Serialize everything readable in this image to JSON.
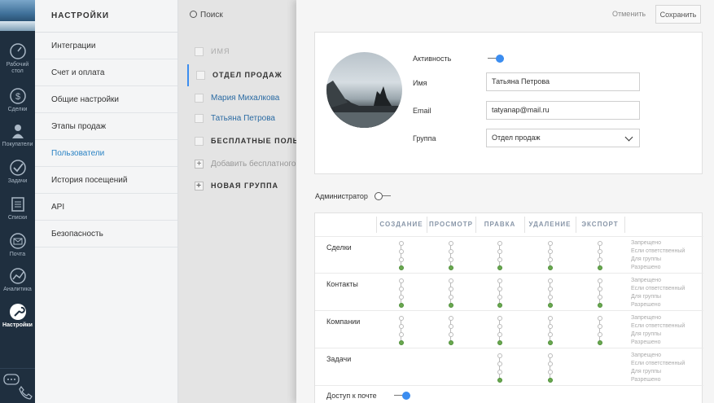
{
  "nav": {
    "items": [
      {
        "name": "desk",
        "label": "Рабочий стол",
        "icon": "speedometer-icon"
      },
      {
        "name": "deals",
        "label": "Сделки",
        "icon": "dollar-icon"
      },
      {
        "name": "customers",
        "label": "Покупатели",
        "icon": "customers-icon"
      },
      {
        "name": "tasks",
        "label": "Задачи",
        "icon": "checkmark-icon"
      },
      {
        "name": "lists",
        "label": "Списки",
        "icon": "list-icon"
      },
      {
        "name": "mail",
        "label": "Почта",
        "icon": "envelope-icon"
      },
      {
        "name": "analytics",
        "label": "Аналитика",
        "icon": "analytics-icon"
      },
      {
        "name": "settings",
        "label": "Настройки",
        "icon": "wrench-icon"
      }
    ]
  },
  "settings": {
    "title": "НАСТРОЙКИ",
    "items": [
      "Интеграции",
      "Счет и оплата",
      "Общие настройки",
      "Этапы продаж",
      "Пользователи",
      "История посещений",
      "API",
      "Безопасность"
    ],
    "active_index": 4
  },
  "list": {
    "search_placeholder": "Поиск",
    "header": "ИМЯ",
    "group_sales": "ОТДЕЛ ПРОДАЖ",
    "users": [
      "Мария Михалкова",
      "Татьяна Петрова"
    ],
    "group_free": "БЕСПЛАТНЫЕ ПОЛЬЗ",
    "add_free": "Добавить бесплатного п",
    "new_group": "НОВАЯ ГРУППА"
  },
  "panel": {
    "cancel_label": "Отменить",
    "save_label": "Сохранить",
    "activity_label": "Активность",
    "activity_on": true,
    "name_label": "Имя",
    "name_value": "Татьяна Петрова",
    "email_label": "Email",
    "email_value": "tatyanap@mail.ru",
    "group_label": "Группа",
    "group_value": "Отдел продаж",
    "admin_label": "Администратор",
    "admin_on": false,
    "columns": [
      "СОЗДАНИЕ",
      "ПРОСМОТР",
      "ПРАВКА",
      "УДАЛЕНИЕ",
      "ЭКСПОРТ"
    ],
    "levels": [
      "Запрещено",
      "Если ответственный",
      "Для группы",
      "Разрешено"
    ],
    "entities": [
      {
        "name": "Сделки",
        "perms": [
          3,
          3,
          3,
          3,
          3
        ]
      },
      {
        "name": "Контакты",
        "perms": [
          3,
          3,
          3,
          3,
          3
        ]
      },
      {
        "name": "Компании",
        "perms": [
          3,
          3,
          3,
          3,
          3
        ]
      },
      {
        "name": "Задачи",
        "perms": [
          null,
          null,
          3,
          3,
          null
        ]
      }
    ],
    "mail_access_label": "Доступ к почте",
    "mail_access_on": true
  }
}
